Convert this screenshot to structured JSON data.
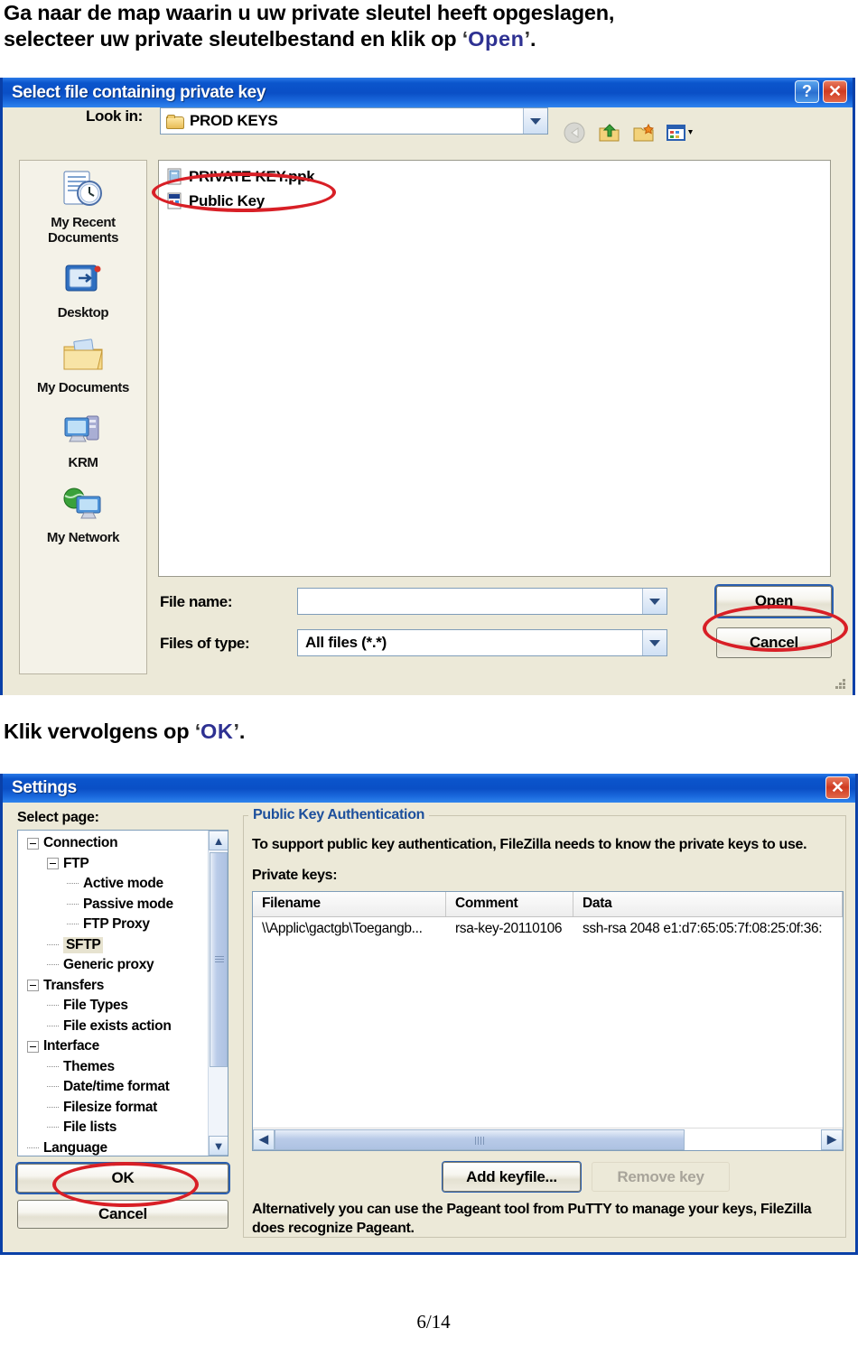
{
  "document": {
    "intro_line1": "Ga naar de map waarin u uw private sleutel heeft opgeslagen,",
    "intro_line2_pre": "selecteer uw private sleutelbestand en klik op ",
    "intro_accent": "Open",
    "intro_line2_post": ".",
    "mid_pre": "Klik vervolgens op ",
    "mid_accent": "OK",
    "mid_post": ".",
    "page_number": "6/14",
    "accent_color": "#2e3192"
  },
  "file_dialog": {
    "title": "Select file containing private key",
    "help_button": "?",
    "close_button": "✕",
    "lookin_label": "Look in:",
    "lookin_value": "PROD KEYS",
    "toolbar_icons": [
      "back-icon",
      "up-one-level-icon",
      "create-new-folder-icon",
      "views-icon"
    ],
    "places": [
      {
        "name": "my-recent-documents",
        "label": "My Recent\nDocuments"
      },
      {
        "name": "desktop",
        "label": "Desktop"
      },
      {
        "name": "my-documents",
        "label": "My Documents"
      },
      {
        "name": "krm",
        "label": "KRM"
      },
      {
        "name": "my-network",
        "label": "My Network"
      }
    ],
    "files": [
      {
        "name": "PRIVATE KEY.ppk",
        "icon": "ppk-file-icon",
        "highlighted": true
      },
      {
        "name": "Public Key",
        "icon": "certificate-file-icon",
        "highlighted": false
      }
    ],
    "filename_label": "File name:",
    "filename_value": "",
    "filetype_label": "Files of type:",
    "filetype_value": "All files (*.*)",
    "open_button": "Open",
    "cancel_button": "Cancel"
  },
  "settings_dialog": {
    "title": "Settings",
    "close_button": "✕",
    "select_page_label": "Select page:",
    "tree": [
      {
        "label": "Connection",
        "depth": 0,
        "expander": true,
        "selected": false
      },
      {
        "label": "FTP",
        "depth": 1,
        "expander": true,
        "selected": false
      },
      {
        "label": "Active mode",
        "depth": 2,
        "expander": false,
        "selected": false
      },
      {
        "label": "Passive mode",
        "depth": 2,
        "expander": false,
        "selected": false
      },
      {
        "label": "FTP Proxy",
        "depth": 2,
        "expander": false,
        "selected": false
      },
      {
        "label": "SFTP",
        "depth": 1,
        "expander": false,
        "selected": true
      },
      {
        "label": "Generic proxy",
        "depth": 1,
        "expander": false,
        "selected": false
      },
      {
        "label": "Transfers",
        "depth": 0,
        "expander": true,
        "selected": false
      },
      {
        "label": "File Types",
        "depth": 1,
        "expander": false,
        "selected": false
      },
      {
        "label": "File exists action",
        "depth": 1,
        "expander": false,
        "selected": false
      },
      {
        "label": "Interface",
        "depth": 0,
        "expander": true,
        "selected": false
      },
      {
        "label": "Themes",
        "depth": 1,
        "expander": false,
        "selected": false
      },
      {
        "label": "Date/time format",
        "depth": 1,
        "expander": false,
        "selected": false
      },
      {
        "label": "Filesize format",
        "depth": 1,
        "expander": false,
        "selected": false
      },
      {
        "label": "File lists",
        "depth": 1,
        "expander": false,
        "selected": false
      },
      {
        "label": "Language",
        "depth": 0,
        "expander": false,
        "selected": false
      }
    ],
    "ok_button": "OK",
    "cancel_button": "Cancel",
    "group_title": "Public Key Authentication",
    "support_text": "To support public key authentication, FileZilla needs to know the private keys to use.",
    "private_keys_label": "Private keys:",
    "grid_headers": [
      "Filename",
      "Comment",
      "Data"
    ],
    "grid_rows": [
      {
        "filename": "\\\\Applic\\gactgb\\Toegangb...",
        "comment": "rsa-key-20110106",
        "data": "ssh-rsa 2048 e1:d7:65:05:7f:08:25:0f:36:"
      }
    ],
    "add_keyfile_button": "Add keyfile...",
    "remove_key_button": "Remove key",
    "alt_text": "Alternatively you can use the Pageant tool from PuTTY to manage your keys, FileZilla does recognize Pageant."
  }
}
